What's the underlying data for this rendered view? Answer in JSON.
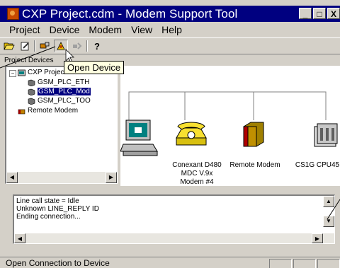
{
  "window": {
    "title": "CXP Project.cdm - Modem Support Tool",
    "minimize": "_",
    "maximize": "□",
    "close": "X"
  },
  "menu": [
    "Project",
    "Device",
    "Modem",
    "View",
    "Help"
  ],
  "toolbar": {
    "tooltip": "Open Device",
    "help_glyph": "?"
  },
  "tree": {
    "header": "Project Devices",
    "root": "CXP Project.cdm",
    "items": [
      "GSM_PLC_ETH",
      "GSM_PLC_Mod",
      "GSM_PLC_TOO"
    ],
    "selected_index": 1,
    "remote": "Remote Modem"
  },
  "diagram": {
    "devices": [
      {
        "name": "computer",
        "label": ""
      },
      {
        "name": "modem",
        "label_lines": [
          "Conexant D480",
          "MDC V.9x",
          "Modem #4"
        ]
      },
      {
        "name": "remote-modem",
        "label_lines": [
          "Remote Modem"
        ]
      },
      {
        "name": "plc",
        "label_lines": [
          "CS1G CPU45"
        ]
      }
    ]
  },
  "log": {
    "lines": [
      "Line call state = Idle",
      "Unknown LINE_REPLY ID",
      "Ending connection..."
    ]
  },
  "status": {
    "text": "Open Connection to Device"
  },
  "colors": {
    "titlebar": "#000080",
    "selection": "#000080",
    "tooltip": "#ffffe1",
    "face": "#d4d0c8"
  }
}
